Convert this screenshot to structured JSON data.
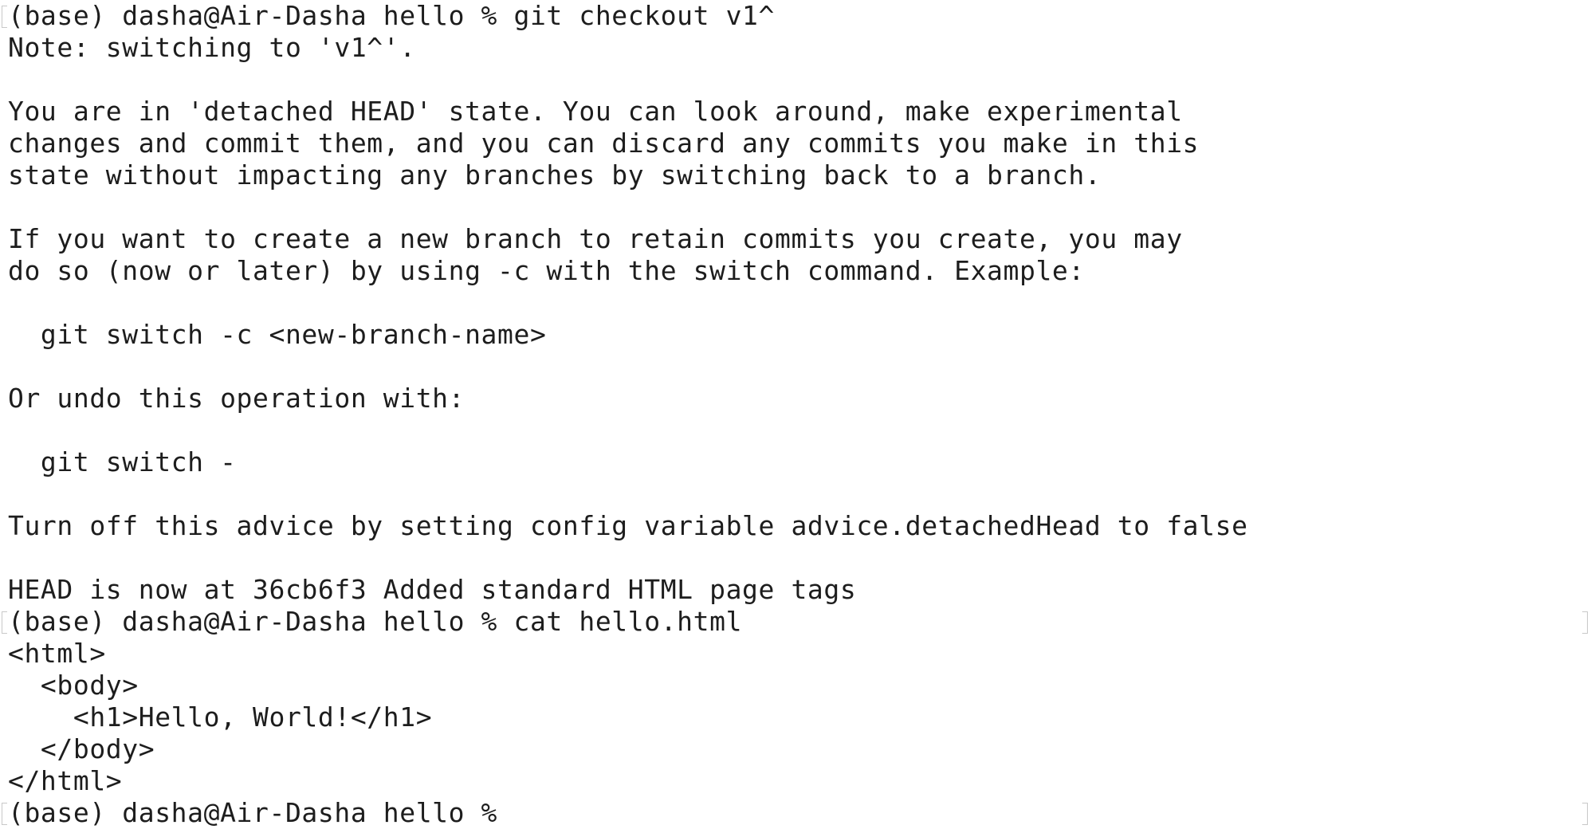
{
  "terminal": {
    "lines": [
      "(base) dasha@Air-Dasha hello % git checkout v1^",
      "Note: switching to 'v1^'.",
      "",
      "You are in 'detached HEAD' state. You can look around, make experimental",
      "changes and commit them, and you can discard any commits you make in this",
      "state without impacting any branches by switching back to a branch.",
      "",
      "If you want to create a new branch to retain commits you create, you may",
      "do so (now or later) by using -c with the switch command. Example:",
      "",
      "  git switch -c <new-branch-name>",
      "",
      "Or undo this operation with:",
      "",
      "  git switch -",
      "",
      "Turn off this advice by setting config variable advice.detachedHead to false",
      "",
      "HEAD is now at 36cb6f3 Added standard HTML page tags",
      "(base) dasha@Air-Dasha hello % cat hello.html",
      "<html>",
      "  <body>",
      "    <h1>Hello, World!</h1>",
      "  </body>",
      "</html>",
      "(base) dasha@Air-Dasha hello % "
    ]
  }
}
